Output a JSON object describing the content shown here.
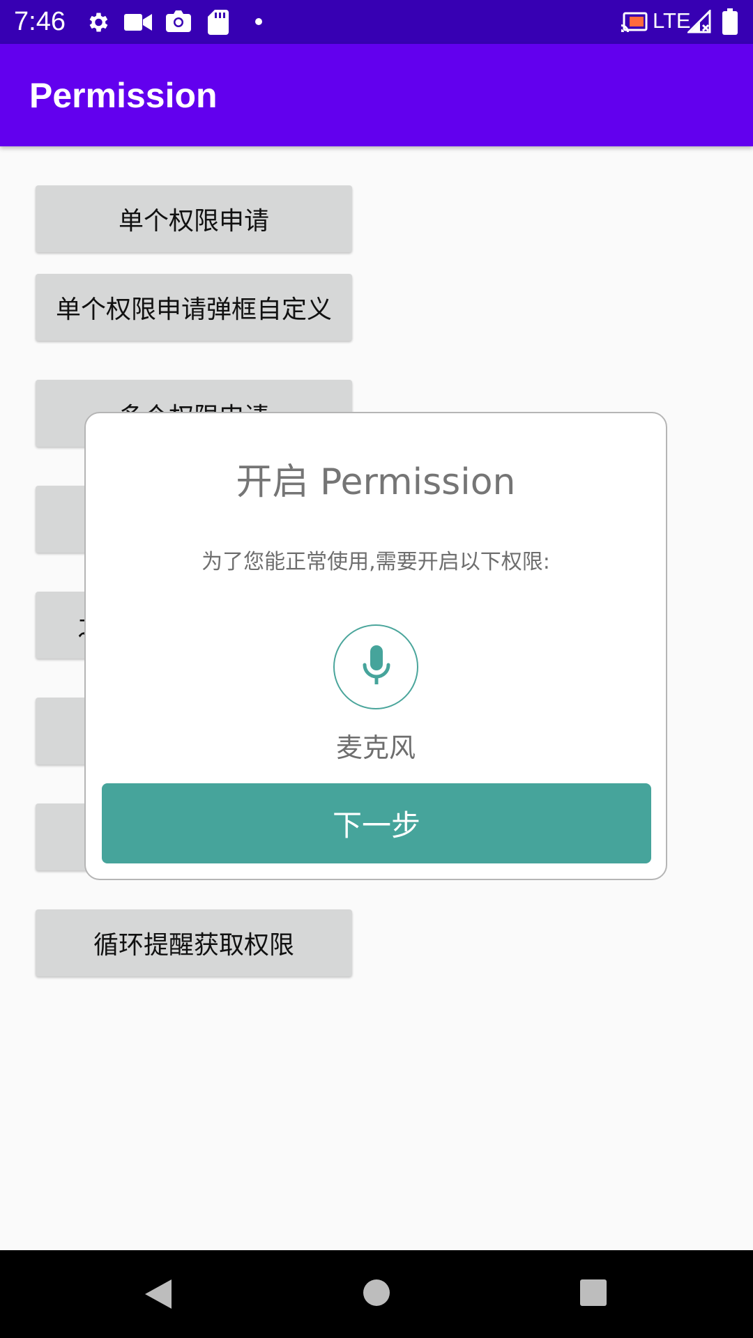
{
  "status_bar": {
    "time": "7:46",
    "network_label": "LTE",
    "left_icons": [
      "settings-icon",
      "video-camera-icon",
      "camera-icon",
      "sd-card-icon",
      "dot-icon"
    ],
    "right_icons": [
      "cast-icon",
      "signal-icon",
      "battery-icon"
    ]
  },
  "app_bar": {
    "title": "Permission"
  },
  "buttons": {
    "single_permission": "单个权限申请",
    "single_custom_dialog": "单个权限申请弹框自定义",
    "multi_permission": "多个权限申请",
    "partial_char": "之",
    "loop_reminder": "循环提醒获取权限"
  },
  "dialog": {
    "title": "开启 Permission",
    "subtitle": "为了您能正常使用,需要开启以下权限:",
    "permission_icon": "microphone-icon",
    "permission_label": "麦克风",
    "next_button": "下一步",
    "accent_color": "#46a49b"
  },
  "nav_bar": {
    "icons": [
      "back-icon",
      "home-icon",
      "recents-icon"
    ]
  },
  "colors": {
    "status_bar": "#3700b3",
    "app_bar": "#6200ee",
    "button_bg": "#d6d7d7",
    "dialog_accent": "#46a49b"
  }
}
